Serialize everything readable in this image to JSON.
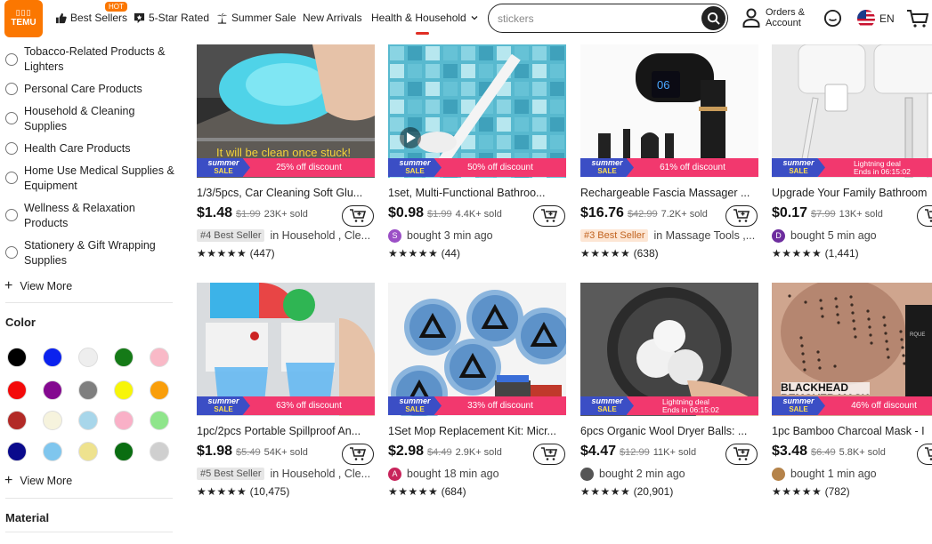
{
  "header": {
    "logo": {
      "line1": "▯▯▯",
      "line2": "TEMU"
    },
    "nav": [
      {
        "label": "Best Sellers",
        "icon": "thumbs-up-icon"
      },
      {
        "label": "5-Star Rated",
        "icon": "star-badge-icon"
      },
      {
        "label": "Summer Sale",
        "icon": "palm-tree-icon"
      },
      {
        "label": "New Arrivals",
        "icon": ""
      },
      {
        "label": "Health & Household",
        "icon": "chevron-down-icon"
      }
    ],
    "hot_badge": "HOT",
    "search_value": "stickers",
    "account_line1": "Orders &",
    "account_line2": "Account",
    "language": "EN"
  },
  "sidebar": {
    "categories": [
      "Tobacco-Related Products & Lighters",
      "Personal Care Products",
      "Household & Cleaning Supplies",
      "Health Care Products",
      "Home Use Medical Supplies & Equipment",
      "Wellness & Relaxation Products",
      "Stationery & Gift Wrapping Supplies"
    ],
    "view_more": "View More",
    "color_title": "Color",
    "colors": [
      "#000000",
      "#0b22ee",
      "#eeeeee",
      "#157a17",
      "#f9b9c7",
      "#f30a0a",
      "#840990",
      "#7f7f7f",
      "#f7f509",
      "#f99e0b",
      "#b22a27",
      "#f6f3dd",
      "#a8d6ea",
      "#f9b0c7",
      "#8fe58b",
      "#0a0a8c",
      "#7fc6ee",
      "#eee28e",
      "#0a6d11",
      "#cfcfcf"
    ],
    "view_more_2": "View More",
    "material_title": "Material"
  },
  "promo": {
    "summer_line1": "summer",
    "summer_line2": "SALE",
    "flash_line1": "Lightning deal",
    "flash_line2": "Ends in 06:15:02"
  },
  "products": [
    {
      "title": "1/3/5pcs, Car Cleaning Soft Glu...",
      "price": "$1.48",
      "old": "$1.99",
      "sold": "23K+ sold",
      "badge": "#4 Best Seller",
      "badge_color": "gray",
      "meta": "in Household , Cle...",
      "avatar": "",
      "avatar_color": "",
      "stars": "★★★★★",
      "reviews": "(447)",
      "promo": "25% off discount",
      "promo_type": "discount",
      "overlay": "It will be clean once stuck!"
    },
    {
      "title": "1set, Multi-Functional Bathroo...",
      "price": "$0.98",
      "old": "$1.99",
      "sold": "4.4K+ sold",
      "badge": "",
      "badge_color": "",
      "meta": "bought 3 min ago",
      "avatar": "S",
      "avatar_color": "#9b4fc6",
      "stars": "★★★★★",
      "reviews": "(44)",
      "promo": "50% off discount",
      "promo_type": "discount",
      "overlay": ""
    },
    {
      "title": "Rechargeable Fascia Massager ...",
      "price": "$16.76",
      "old": "$42.99",
      "sold": "7.2K+ sold",
      "badge": "#3 Best Seller",
      "badge_color": "orange",
      "meta": "in Massage Tools ,...",
      "avatar": "",
      "avatar_color": "",
      "stars": "★★★★★",
      "reviews": "(638)",
      "promo": "61% off discount",
      "promo_type": "discount",
      "overlay": "06"
    },
    {
      "title": "Upgrade Your Family Bathroom",
      "price": "$0.17",
      "old": "$7.99",
      "sold": "13K+ sold",
      "badge": "",
      "badge_color": "",
      "meta": "bought 5 min ago",
      "avatar": "D",
      "avatar_color": "#6d2d9e",
      "stars": "★★★★★",
      "reviews": "(1,441)",
      "promo": "",
      "promo_type": "flash",
      "overlay": ""
    },
    {
      "title": "1pc/2pcs Portable Spillproof An...",
      "price": "$1.98",
      "old": "$5.49",
      "sold": "54K+ sold",
      "badge": "#5 Best Seller",
      "badge_color": "gray",
      "meta": "in Household , Cle...",
      "avatar": "",
      "avatar_color": "",
      "stars": "★★★★★",
      "reviews": "(10,475)",
      "promo": "63% off discount",
      "promo_type": "discount",
      "overlay": ""
    },
    {
      "title": "1Set Mop Replacement Kit: Micr...",
      "price": "$2.98",
      "old": "$4.49",
      "sold": "2.9K+ sold",
      "badge": "",
      "badge_color": "",
      "meta": "bought 18 min ago",
      "avatar": "A",
      "avatar_color": "#c8245b",
      "stars": "★★★★★",
      "reviews": "(684)",
      "promo": "33% off discount",
      "promo_type": "discount",
      "overlay": ""
    },
    {
      "title": "6pcs Organic Wool Dryer Balls: ...",
      "price": "$4.47",
      "old": "$12.99",
      "sold": "11K+ sold",
      "badge": "",
      "badge_color": "",
      "meta": "bought 2 min ago",
      "avatar": "",
      "avatar_color": "#555",
      "stars": "★★★★★",
      "reviews": "(20,901)",
      "promo": "",
      "promo_type": "flash",
      "overlay": ""
    },
    {
      "title": "1pc Bamboo Charcoal Mask - I",
      "price": "$3.48",
      "old": "$6.49",
      "sold": "5.8K+ sold",
      "badge": "",
      "badge_color": "",
      "meta": "bought 1 min ago",
      "avatar": "",
      "avatar_color": "#b5834a",
      "stars": "★★★★★",
      "reviews": "(782)",
      "promo": "46% off discount",
      "promo_type": "discount",
      "overlay": "BLACKHEAD REMOVER MASK"
    }
  ]
}
